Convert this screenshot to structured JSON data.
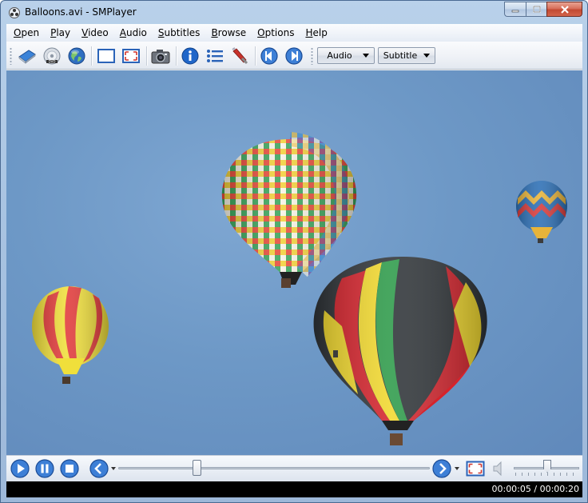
{
  "window": {
    "title": "Balloons.avi - SMPlayer",
    "caption_buttons": [
      "minimize-icon",
      "maximize-icon",
      "close-icon"
    ]
  },
  "menu": [
    "Open",
    "Play",
    "Video",
    "Audio",
    "Subtitles",
    "Browse",
    "Options",
    "Help"
  ],
  "toolbar": {
    "buttons": [
      "open-file-icon",
      "open-dvd-icon",
      "open-url-icon",
      "compact-mode-icon",
      "fullscreen-icon",
      "screenshot-icon",
      "info-icon",
      "playlist-icon",
      "preferences-icon",
      "previous-icon",
      "next-icon"
    ],
    "audio_label": "Audio",
    "subtitle_label": "Subtitle"
  },
  "video": {
    "sky_color": "#6d98c6"
  },
  "controls": {
    "buttons": [
      "play-icon",
      "pause-icon",
      "stop-icon",
      "rewind-icon",
      "forward-icon",
      "fullscreen-icon",
      "volume-icon"
    ],
    "seek_fraction": 0.25,
    "volume_fraction": 0.5
  },
  "status": {
    "time": "00:00:05 / 00:00:20"
  },
  "colors": {
    "accent_blue": "#2a63b8",
    "title_bar": "#b9d1ea",
    "close_red": "#c24a32",
    "status_bg": "#000000"
  }
}
